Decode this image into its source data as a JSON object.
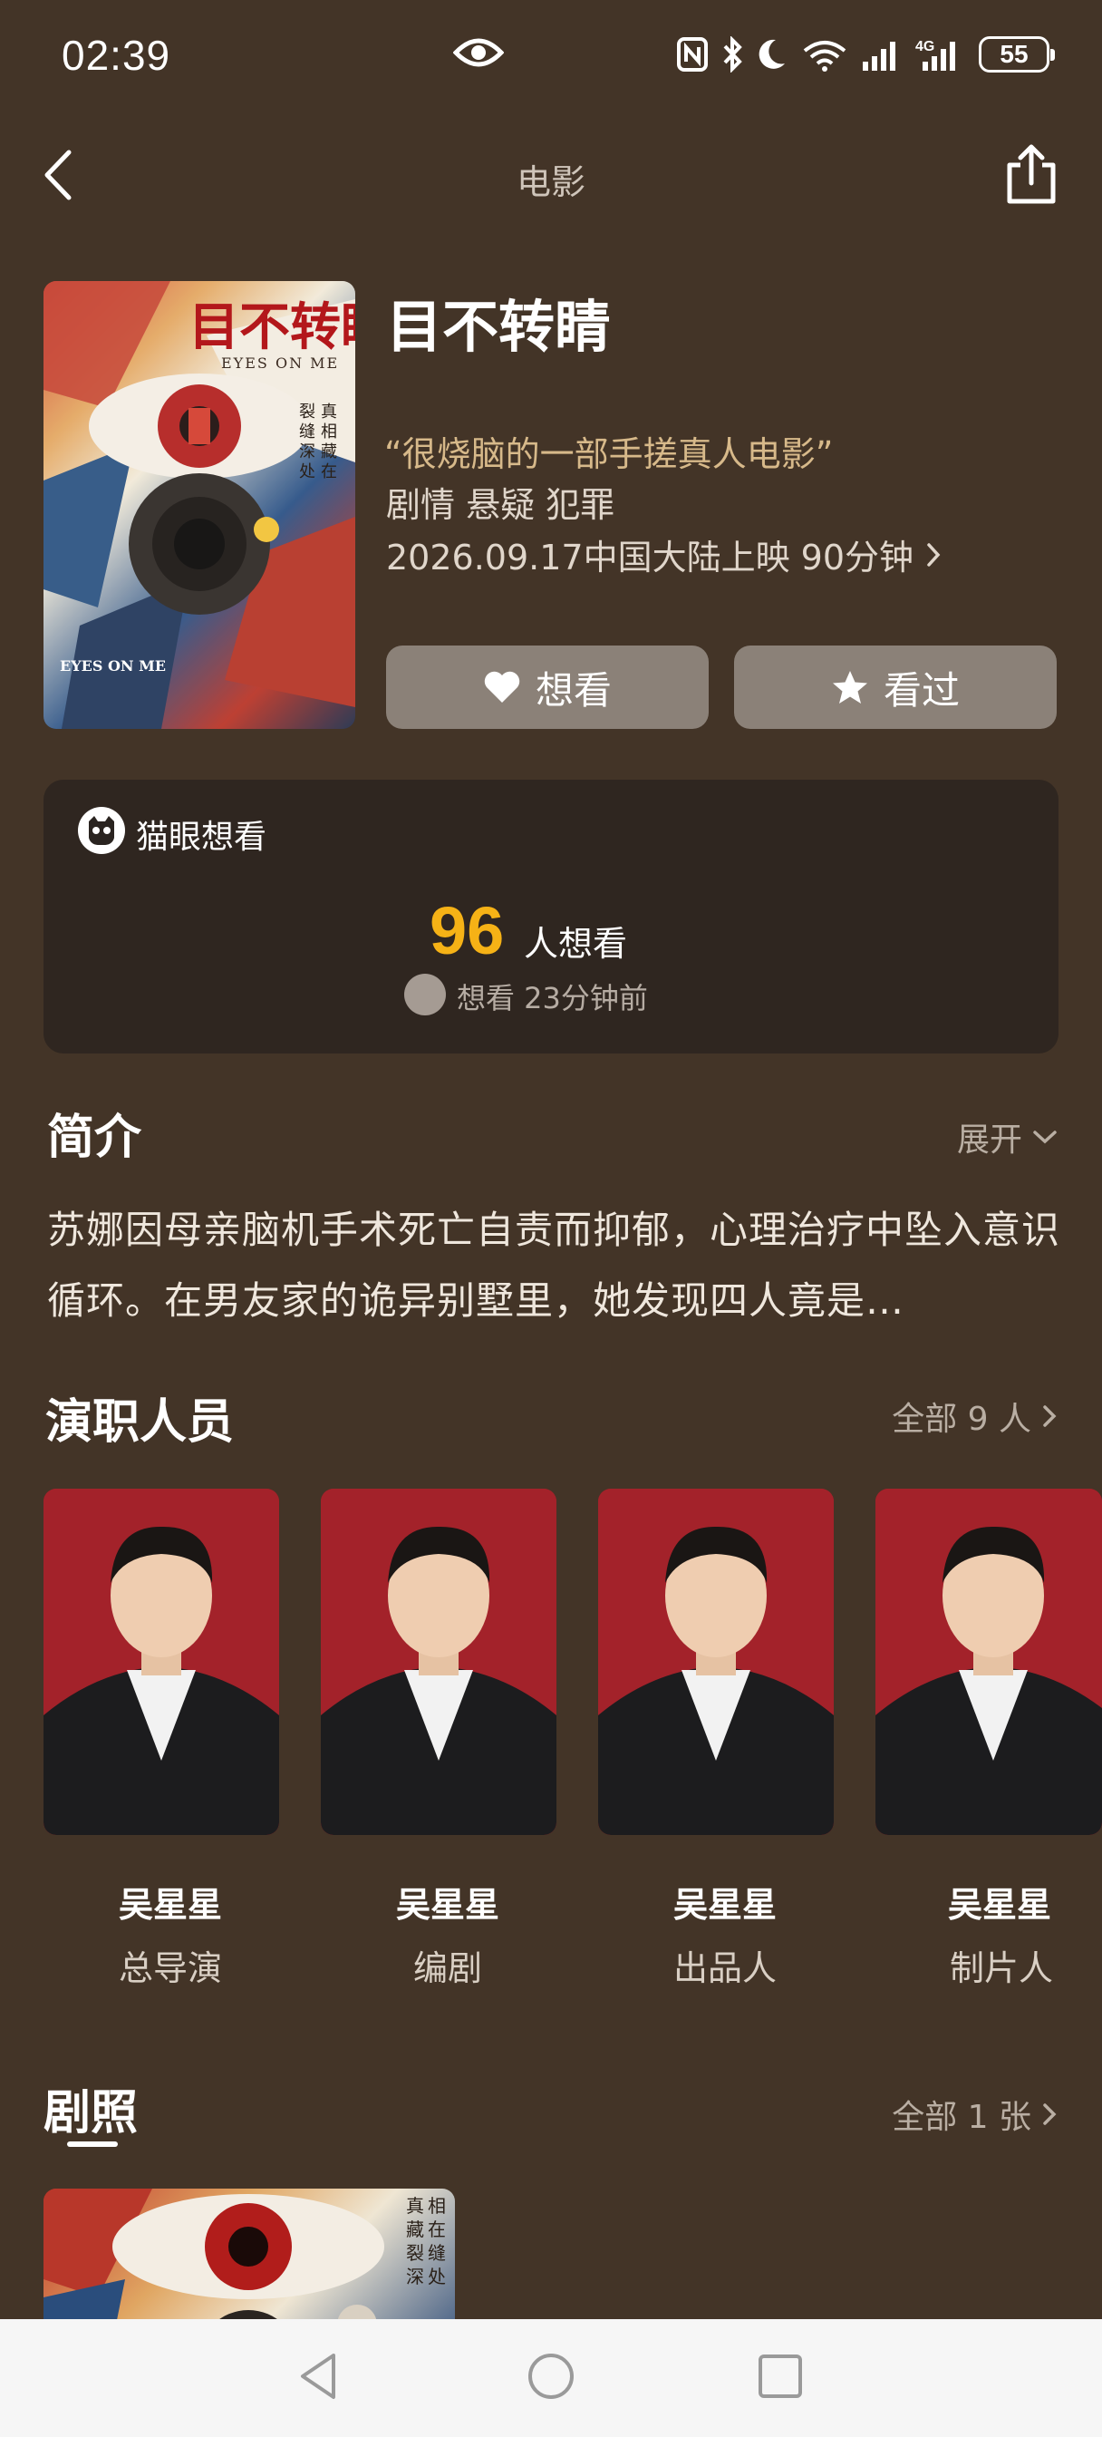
{
  "status_bar": {
    "time": "02:39",
    "battery": "55",
    "network_label": "4G"
  },
  "nav": {
    "title": "电影"
  },
  "movie": {
    "title": "目不转睛",
    "tagline": "“很烧脑的一部手搓真人电影”",
    "genres": "剧情 悬疑 犯罪",
    "release": "2026.09.17中国大陆上映 90分钟",
    "poster": {
      "title": "目不转睛",
      "english_title": "EYES ON ME",
      "side_text": [
        "真",
        "相",
        "藏",
        "在",
        "裂",
        "缝",
        "深",
        "处"
      ]
    }
  },
  "actions": {
    "want_label": "想看",
    "seen_label": "看过"
  },
  "maoyan": {
    "label": "猫眼想看",
    "count": "96",
    "count_unit": "人想看",
    "recent": "想看  23分钟前"
  },
  "synopsis": {
    "title": "简介",
    "expand_label": "展开",
    "text": "苏娜因母亲脑机手术死亡自责而抑郁，心理治疗中坠入意识循环。在男友家的诡异别墅里，她发现四人竟是…"
  },
  "cast": {
    "title": "演职人员",
    "all_label": "全部 9 人",
    "members": [
      {
        "name": "吴星星",
        "role": "总导演"
      },
      {
        "name": "吴星星",
        "role": "编剧"
      },
      {
        "name": "吴星星",
        "role": "出品人"
      },
      {
        "name": "吴星星",
        "role": "制片人"
      }
    ]
  },
  "stills": {
    "title": "剧照",
    "all_label": "全部 1 张"
  },
  "colors": {
    "background": "#433427",
    "card": "#2f2620",
    "accent": "#f6b216",
    "tagline": "#d7b98a",
    "button": "#8b8178"
  }
}
